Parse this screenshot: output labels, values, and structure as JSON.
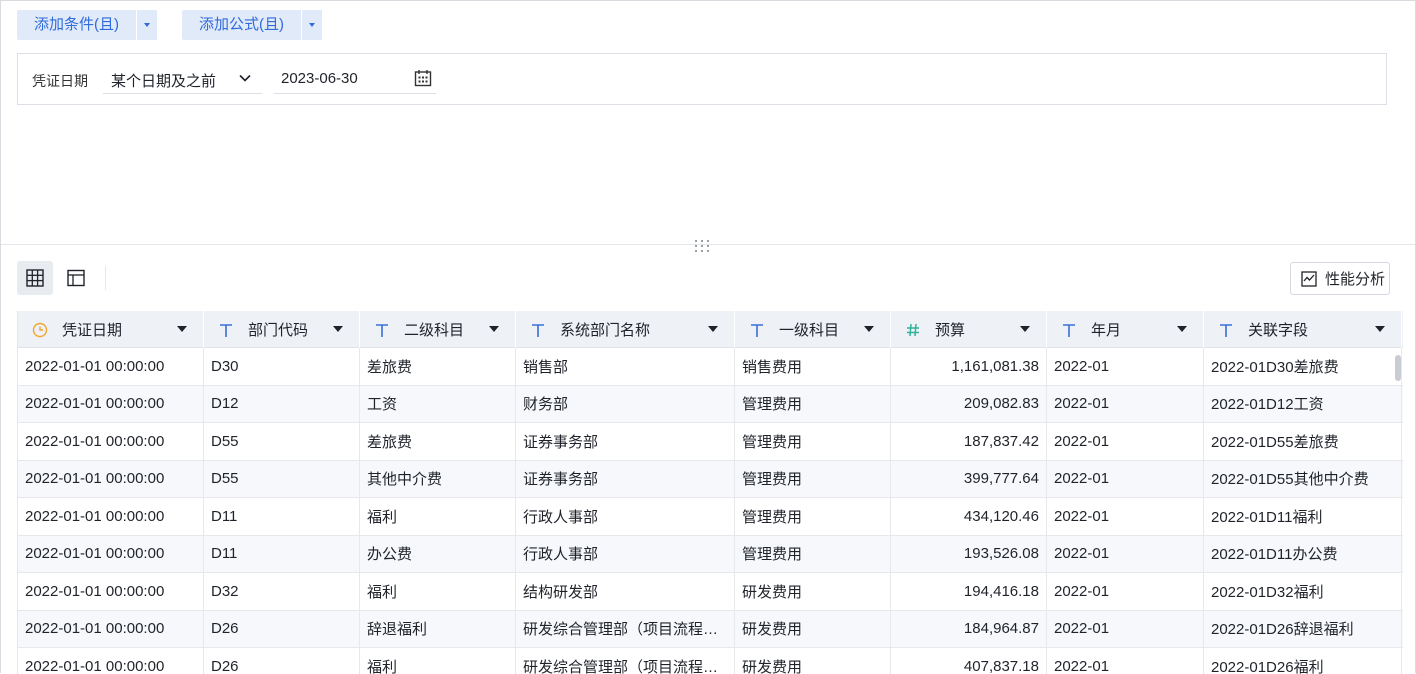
{
  "toolbar": {
    "add_condition": "添加条件(且)",
    "add_formula": "添加公式(且)"
  },
  "filter": {
    "label": "凭证日期",
    "operator": "某个日期及之前",
    "date": "2023-06-30"
  },
  "view": {
    "perf_label": "性能分析"
  },
  "colors": {
    "accent": "#2f6bdc",
    "button_bg": "#e1eaf8",
    "header_bg": "#eef1f6",
    "date_icon": "#f2a531",
    "text_icon": "#3b6fd8",
    "number_icon": "#2fb39a"
  },
  "columns": [
    {
      "label": "凭证日期",
      "icon": "clock-icon"
    },
    {
      "label": "部门代码",
      "icon": "text-type-icon"
    },
    {
      "label": "二级科目",
      "icon": "text-type-icon"
    },
    {
      "label": "系统部门名称",
      "icon": "text-type-icon"
    },
    {
      "label": "一级科目",
      "icon": "text-type-icon"
    },
    {
      "label": "预算",
      "icon": "number-type-icon"
    },
    {
      "label": "年月",
      "icon": "text-type-icon"
    },
    {
      "label": "关联字段",
      "icon": "text-type-icon"
    }
  ],
  "rows": [
    [
      "2022-01-01 00:00:00",
      "D30",
      "差旅费",
      "销售部",
      "销售费用",
      "1,161,081.38",
      "2022-01",
      "2022-01D30差旅费"
    ],
    [
      "2022-01-01 00:00:00",
      "D12",
      "工资",
      "财务部",
      "管理费用",
      "209,082.83",
      "2022-01",
      "2022-01D12工资"
    ],
    [
      "2022-01-01 00:00:00",
      "D55",
      "差旅费",
      "证券事务部",
      "管理费用",
      "187,837.42",
      "2022-01",
      "2022-01D55差旅费"
    ],
    [
      "2022-01-01 00:00:00",
      "D55",
      "其他中介费",
      "证券事务部",
      "管理费用",
      "399,777.64",
      "2022-01",
      "2022-01D55其他中介费"
    ],
    [
      "2022-01-01 00:00:00",
      "D11",
      "福利",
      "行政人事部",
      "管理费用",
      "434,120.46",
      "2022-01",
      "2022-01D11福利"
    ],
    [
      "2022-01-01 00:00:00",
      "D11",
      "办公费",
      "行政人事部",
      "管理费用",
      "193,526.08",
      "2022-01",
      "2022-01D11办公费"
    ],
    [
      "2022-01-01 00:00:00",
      "D32",
      "福利",
      "结构研发部",
      "研发费用",
      "194,416.18",
      "2022-01",
      "2022-01D32福利"
    ],
    [
      "2022-01-01 00:00:00",
      "D26",
      "辞退福利",
      "研发综合管理部（项目流程…",
      "研发费用",
      "184,964.87",
      "2022-01",
      "2022-01D26辞退福利"
    ],
    [
      "2022-01-01 00:00:00",
      "D26",
      "福利",
      "研发综合管理部（项目流程…",
      "研发费用",
      "407,837.18",
      "2022-01",
      "2022-01D26福利"
    ]
  ]
}
